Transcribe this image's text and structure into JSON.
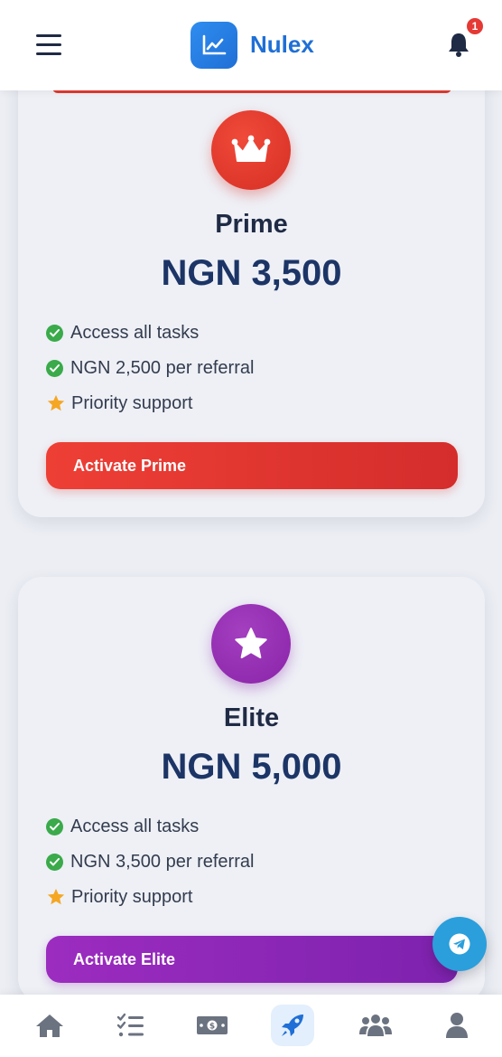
{
  "header": {
    "brand": "Nulex",
    "notification_count": "1"
  },
  "plans": [
    {
      "name": "Prime",
      "price": "NGN 3,500",
      "features": [
        {
          "icon": "check-circle-icon",
          "text": "Access all tasks"
        },
        {
          "icon": "check-circle-icon",
          "text": "NGN 2,500 per referral"
        },
        {
          "icon": "star-icon",
          "text": "Priority support"
        }
      ],
      "button_label": "Activate Prime",
      "accent": "#e03a2f"
    },
    {
      "name": "Elite",
      "price": "NGN 5,000",
      "features": [
        {
          "icon": "check-circle-icon",
          "text": "Access all tasks"
        },
        {
          "icon": "check-circle-icon",
          "text": "NGN 3,500 per referral"
        },
        {
          "icon": "star-icon",
          "text": "Priority support"
        }
      ],
      "button_label": "Activate Elite",
      "accent": "#8a23a8"
    }
  ],
  "bottom_nav": [
    {
      "icon": "home-icon"
    },
    {
      "icon": "tasks-icon"
    },
    {
      "icon": "money-icon"
    },
    {
      "icon": "rocket-icon",
      "active": true
    },
    {
      "icon": "users-icon"
    },
    {
      "icon": "profile-icon"
    }
  ],
  "colors": {
    "primary": "#1f6fd6",
    "prime": "#e03a2f",
    "elite": "#8a23a8",
    "check": "#3aaa4a",
    "star": "#f5a623",
    "telegram": "#2a9fdc"
  }
}
